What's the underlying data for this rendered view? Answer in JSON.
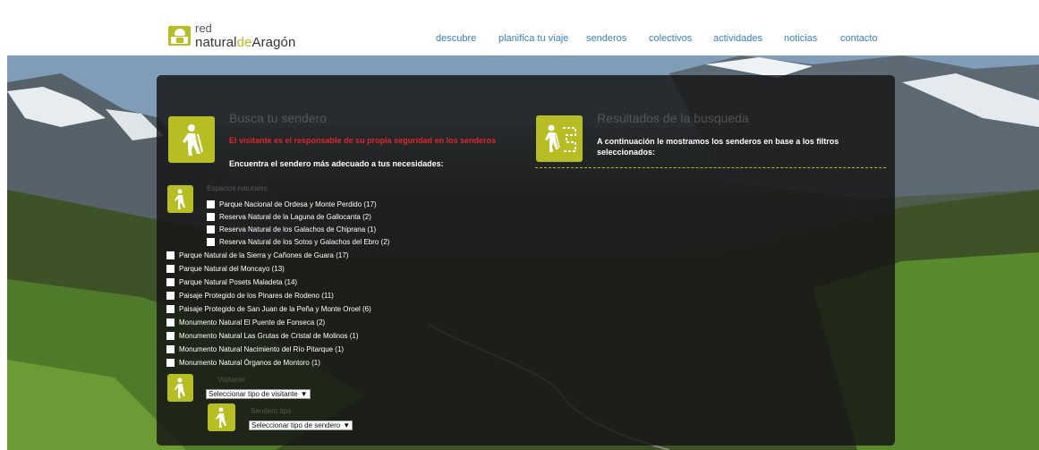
{
  "brand": {
    "line1": "red",
    "name_a": "natural",
    "name_de": "de",
    "name_b": "Aragón"
  },
  "nav": [
    {
      "label": "descubre"
    },
    {
      "label": "planifica tu viaje"
    },
    {
      "label": "senderos"
    },
    {
      "label": "colectivos"
    },
    {
      "label": "actividades"
    },
    {
      "label": "noticias"
    },
    {
      "label": "contacto"
    }
  ],
  "search": {
    "heading": "Busca tu sendero",
    "warning": "El visitante es el responsable de su propia seguridad en los senderos",
    "find_text": "Encuentra el sendero más adecuado a tus necesidades:",
    "spaces_label": "Espacios naturales",
    "spaces_nested": [
      "Parque Nacional de Ordesa y Monte Perdido (17)",
      "Reserva Natural de la Laguna de Gallocanta (2)",
      "Reserva Natural de los Galachos de Chiprana (1)",
      "Reserva Natural de los Sotos y Galachos del Ebro (2)"
    ],
    "spaces": [
      "Parque Natural de la Sierra y Cañones de Guara (17)",
      "Parque Natural del Moncayo (13)",
      "Parque Natural Posets Maladeta (14)",
      "Paisaje Protegido de los Pinares de Rodeno (11)",
      "Paisaje Protegido de San Juan de la Peña y Monte Oroel (6)",
      "Monumento Natural El Puente de Fonseca (2)",
      "Monumento Natural Las Grutas de Cristal de Molinos (1)",
      "Monumento Natural Nacimiento del Río Pitarque (1)",
      "Monumento Natural Órganos de Montoro (1)"
    ],
    "visitor_label": "Visitante",
    "visitor_select": "Seleccionar tipo de visitante",
    "trail_label": "Sendero tipo",
    "trail_select": "Seleccionar tipo de sendero"
  },
  "results": {
    "heading": "Resultados de la busqueda",
    "text": "A continuación le mostramos los senderos en base a los filtros seleccionados:"
  },
  "colors": {
    "accent": "#b7be24",
    "nav_link": "#3a7fc2",
    "warning": "#e0242c"
  },
  "icons": [
    "hiker-icon",
    "map-hiker-icon"
  ]
}
